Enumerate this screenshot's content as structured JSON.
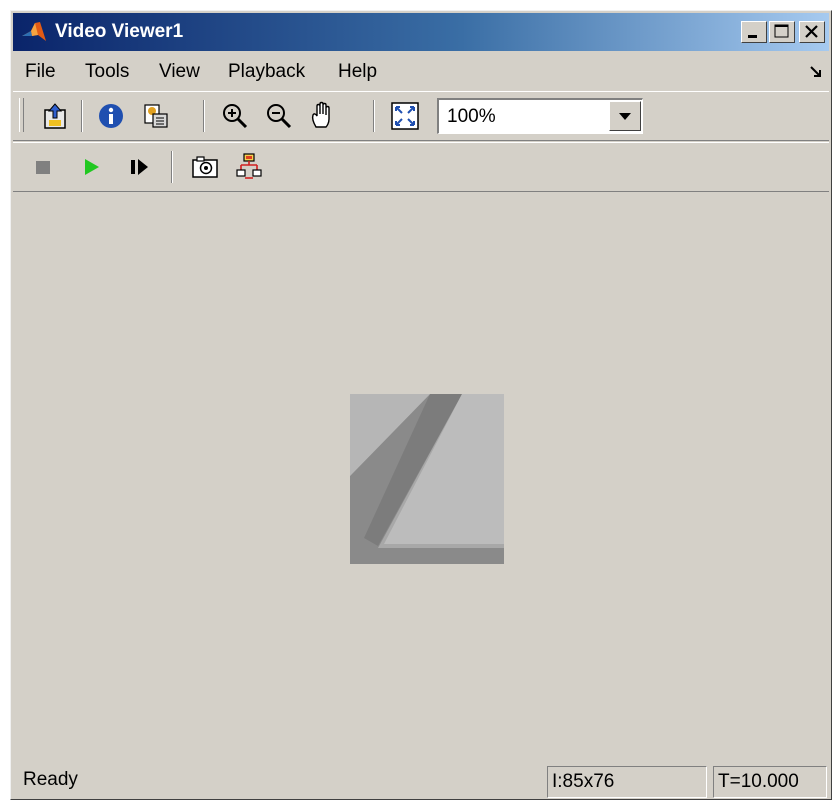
{
  "window": {
    "title": "Video Viewer1",
    "title_gradient": [
      "#0a246a",
      "#a6caf0"
    ],
    "face_color": "#d4d0c8"
  },
  "menu": {
    "items": [
      "File",
      "Tools",
      "View",
      "Playback",
      "Help"
    ]
  },
  "toolbar": {
    "icons": [
      "print-to-figure-icon",
      "info-icon",
      "colormap-icon",
      "zoom-in-icon",
      "zoom-out-icon",
      "pan-hand-icon",
      "fit-to-view-icon"
    ],
    "zoom_value": "100%"
  },
  "playback_toolbar": {
    "icons": [
      "stop-icon",
      "play-icon",
      "step-forward-icon",
      "snapshot-camera-icon",
      "highlight-simulink-signal-icon"
    ],
    "play_color": "#21c821"
  },
  "status": {
    "message": "Ready",
    "image_size": "I:85x76",
    "time": "T=10.000"
  }
}
